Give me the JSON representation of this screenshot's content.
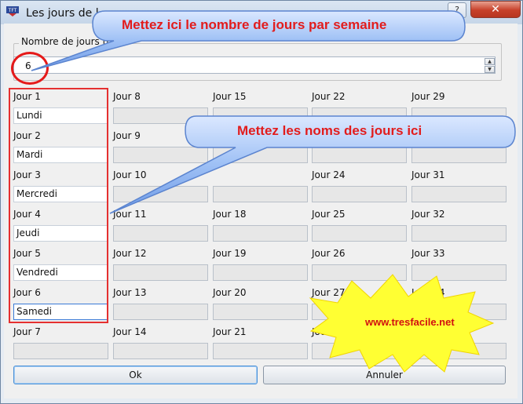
{
  "window": {
    "title": "Les jours de l",
    "help_label": "?",
    "close_label": "✕"
  },
  "group": {
    "label": "Nombre de jours travai"
  },
  "days_per_week": {
    "value": "6"
  },
  "days": [
    {
      "label": "Jour 1",
      "value": "Lundi"
    },
    {
      "label": "Jour 2",
      "value": "Mardi"
    },
    {
      "label": "Jour 3",
      "value": "Mercredi"
    },
    {
      "label": "Jour 4",
      "value": "Jeudi"
    },
    {
      "label": "Jour 5",
      "value": "Vendredi"
    },
    {
      "label": "Jour 6",
      "value": "Samedi"
    },
    {
      "label": "Jour 7",
      "value": ""
    },
    {
      "label": "Jour 8",
      "value": ""
    },
    {
      "label": "Jour 9",
      "value": ""
    },
    {
      "label": "Jour 10",
      "value": ""
    },
    {
      "label": "Jour 11",
      "value": ""
    },
    {
      "label": "Jour 12",
      "value": ""
    },
    {
      "label": "Jour 13",
      "value": ""
    },
    {
      "label": "Jour 14",
      "value": ""
    },
    {
      "label": "Jour 15",
      "value": ""
    },
    {
      "label": "",
      "value": ""
    },
    {
      "label": "",
      "value": ""
    },
    {
      "label": "Jour 18",
      "value": ""
    },
    {
      "label": "Jour 19",
      "value": ""
    },
    {
      "label": "Jour 20",
      "value": ""
    },
    {
      "label": "Jour 21",
      "value": ""
    },
    {
      "label": "Jour 22",
      "value": ""
    },
    {
      "label": "",
      "value": ""
    },
    {
      "label": "Jour 24",
      "value": ""
    },
    {
      "label": "Jour 25",
      "value": ""
    },
    {
      "label": "Jour 26",
      "value": ""
    },
    {
      "label": "Jour 27",
      "value": ""
    },
    {
      "label": "Jour 28",
      "value": ""
    },
    {
      "label": "Jour 29",
      "value": ""
    },
    {
      "label": "",
      "value": ""
    },
    {
      "label": "Jour 31",
      "value": ""
    },
    {
      "label": "Jour 32",
      "value": ""
    },
    {
      "label": "Jour 33",
      "value": ""
    },
    {
      "label": "Jour 34",
      "value": ""
    },
    {
      "label": "",
      "value": ""
    }
  ],
  "buttons": {
    "ok": "Ok",
    "cancel": "Annuler"
  },
  "annotations": {
    "callout_days_count": "Mettez ici le nombre de jours par semaine",
    "callout_day_names": "Mettez les noms des  jours ici",
    "website": "www.tresfacile.net"
  },
  "colors": {
    "annotation_red": "#e21c1c",
    "balloon_blue": "#6f9be6",
    "starburst_yellow": "#ffff33"
  }
}
